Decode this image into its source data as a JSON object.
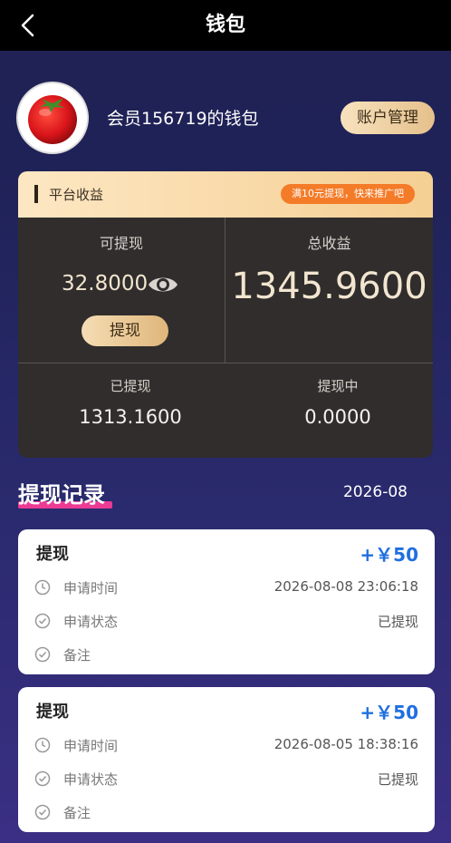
{
  "header": {
    "title": "钱包",
    "back_icon": "chevron-left-icon"
  },
  "profile": {
    "member_label": "会员156719的钱包",
    "account_button": "账户管理",
    "avatar_icon": "tomato-avatar"
  },
  "platform": {
    "title": "平台收益",
    "promo": "满10元提现，快来推广吧",
    "withdrawable_label": "可提现",
    "withdrawable_value": "32.8000",
    "withdraw_button": "提现",
    "total_label": "总收益",
    "total_value": "1345.9600",
    "withdrawn_label": "已提现",
    "withdrawn_value": "1313.1600",
    "pending_label": "提现中",
    "pending_value": "0.0000"
  },
  "records_section": {
    "title": "提现记录",
    "month": "2026-08"
  },
  "records": [
    {
      "title": "提现",
      "amount": "+￥50",
      "time_label": "申请时间",
      "time_value": "2026-08-08 23:06:18",
      "status_label": "申请状态",
      "status_value": "已提现",
      "note_label": "备注"
    },
    {
      "title": "提现",
      "amount": "+￥50",
      "time_label": "申请时间",
      "time_value": "2026-08-05 18:38:16",
      "status_label": "申请状态",
      "status_value": "已提现",
      "note_label": "备注"
    }
  ],
  "colors": {
    "accent_gold": "#e5c08b",
    "amount_blue": "#1f6fe0",
    "highlight_pink": "#ec3b94",
    "promo_orange": "#f47b28"
  }
}
